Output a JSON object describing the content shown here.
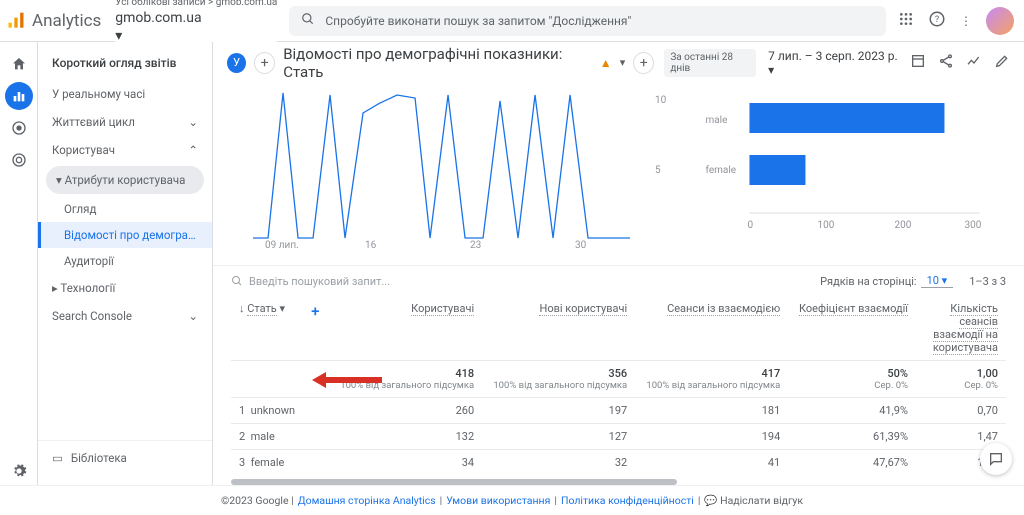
{
  "header": {
    "product": "Analytics",
    "breadcrumb_top": "Усі облікові записи > gmob.com.ua",
    "breadcrumb_main": "gmob.com.ua",
    "search_placeholder": "Спробуйте виконати пошук за запитом \"Дослідження\""
  },
  "sidebar": {
    "title": "Короткий огляд звітів",
    "realtime": "У реальному часі",
    "lifecycle": "Життєвий цикл",
    "user": "Користувач",
    "user_attr": "Атрибути користувача",
    "sub_overview": "Огляд",
    "sub_demo": "Відомості про демографіч...",
    "sub_aud": "Аудиторії",
    "tech": "Технології",
    "search_console": "Search Console",
    "library": "Бібліотека"
  },
  "rail": {
    "home": "home-icon",
    "reports": "reports-icon",
    "explore": "explore-icon",
    "ads": "ads-icon",
    "settings": "settings-icon"
  },
  "report": {
    "title": "Відомості про демографічні показники: Стать",
    "period_label": "За останні 28 днів",
    "date_range": "7 лип. – 3 серп. 2023 р."
  },
  "search_q_placeholder": "Введіть пошуковий запит...",
  "pager": {
    "rows_label": "Рядків на сторінці:",
    "rows_value": "10",
    "range": "1–3 з 3"
  },
  "table": {
    "cols": [
      "Стать",
      "Користувачі",
      "Нові користувачі",
      "Сеанси із взаємодією",
      "Коефіцієнт взаємодії",
      "Кількість сеансів взаємодії на користувача"
    ],
    "totals": {
      "users": "418",
      "new": "356",
      "sessions": "417",
      "rate": "50%",
      "spc": "1,00",
      "users_sub": "100% від загального підсумка",
      "new_sub": "100% від загального підсумка",
      "sessions_sub": "100% від загального підсумка",
      "rate_sub": "Сер. 0%",
      "spc_sub": "Сер. 0%"
    },
    "rows": [
      {
        "n": "1",
        "label": "unknown",
        "users": "260",
        "new": "197",
        "sessions": "181",
        "rate": "41,9%",
        "spc": "0,70"
      },
      {
        "n": "2",
        "label": "male",
        "users": "132",
        "new": "127",
        "sessions": "194",
        "rate": "61,39%",
        "spc": "1,47"
      },
      {
        "n": "3",
        "label": "female",
        "users": "34",
        "new": "32",
        "sessions": "41",
        "rate": "47,67%",
        "spc": "1,21"
      }
    ]
  },
  "chart_data": [
    {
      "type": "line",
      "x": [
        "09 лип.",
        "16",
        "23",
        "30"
      ],
      "y_ticks": [
        5,
        10
      ],
      "series": [
        {
          "name": "",
          "values": [
            0,
            0,
            12,
            0,
            0,
            12,
            0,
            10,
            11,
            12,
            12,
            0,
            12,
            0,
            0,
            11,
            0,
            12,
            0,
            12,
            0,
            0
          ]
        }
      ]
    },
    {
      "type": "bar",
      "orientation": "horizontal",
      "categories": [
        "male",
        "female"
      ],
      "values": [
        260,
        75
      ],
      "x_ticks": [
        0,
        100,
        200,
        300
      ]
    }
  ],
  "footer": {
    "copyright": "©2023 Google |",
    "links": [
      "Домашня сторінка Analytics",
      "Умови використання",
      "Політика конфіденційності"
    ],
    "feedback": "Надіслати відгук"
  }
}
